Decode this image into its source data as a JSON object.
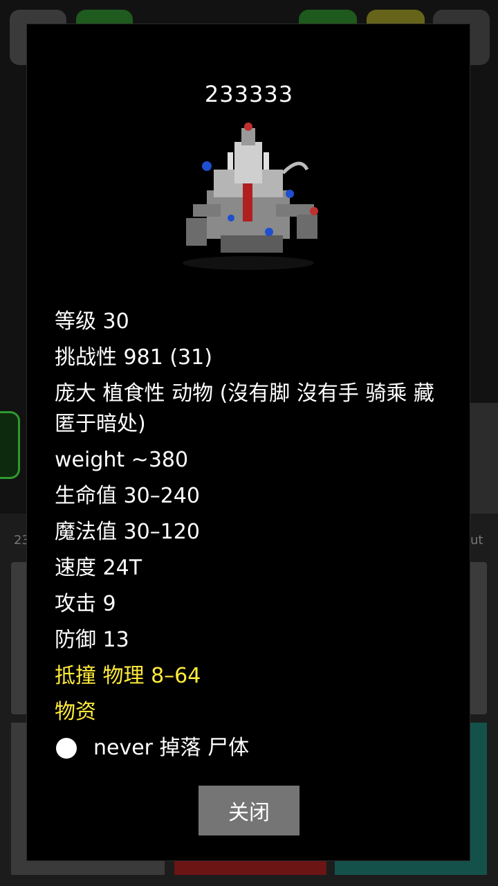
{
  "dialog": {
    "title": "233333",
    "image_icon": "steam-golem-monster-icon",
    "stats": {
      "level": "等级 30",
      "challenge": "挑战性 981 (31)",
      "traits": "庞大 植食性 动物 (沒有脚 沒有手 骑乘 藏匿于暗处)",
      "weight": "weight ~380",
      "hp": "生命值 30–240",
      "mp": "魔法值 30–120",
      "speed": "速度 24T",
      "attack": "攻击 9",
      "defense": "防御 13"
    },
    "attack_line": "抵撞 物理 8–64",
    "loot_header": "物资",
    "loot_item": "never 掉落 尸体",
    "close_label": "关闭",
    "highlight_color": "#ffeb3b"
  },
  "background": {
    "left_text": "23",
    "right_text": "ut"
  }
}
